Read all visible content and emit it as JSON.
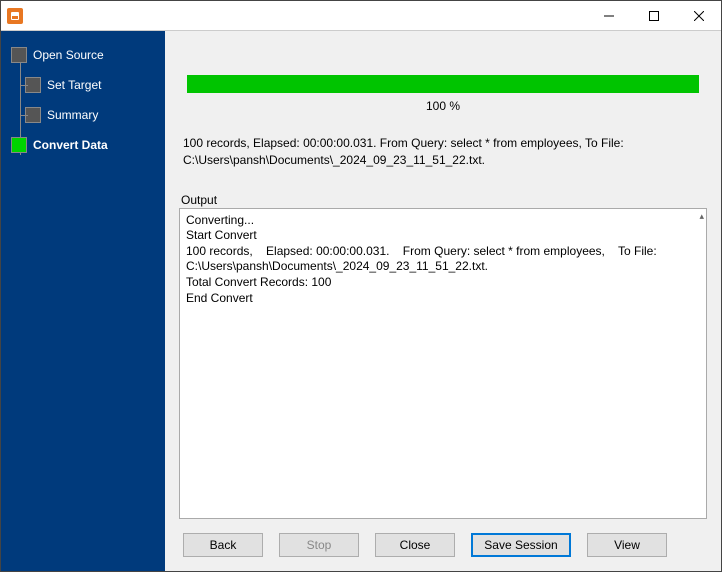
{
  "window": {
    "title": ""
  },
  "sidebar": {
    "items": [
      {
        "label": "Open Source"
      },
      {
        "label": "Set Target"
      },
      {
        "label": "Summary"
      },
      {
        "label": "Convert Data"
      }
    ]
  },
  "progress": {
    "percent_label": "100 %",
    "status_line": "100 records,    Elapsed: 00:00:00.031.    From Query: select * from employees,    To File: C:\\Users\\pansh\\Documents\\_2024_09_23_11_51_22.txt."
  },
  "output": {
    "label": "Output",
    "lines": "Converting...\nStart Convert\n100 records,    Elapsed: 00:00:00.031.    From Query: select * from employees,    To File: C:\\Users\\pansh\\Documents\\_2024_09_23_11_51_22.txt.\nTotal Convert Records: 100\nEnd Convert"
  },
  "buttons": {
    "back": "Back",
    "stop": "Stop",
    "close": "Close",
    "save_session": "Save Session",
    "view": "View"
  }
}
